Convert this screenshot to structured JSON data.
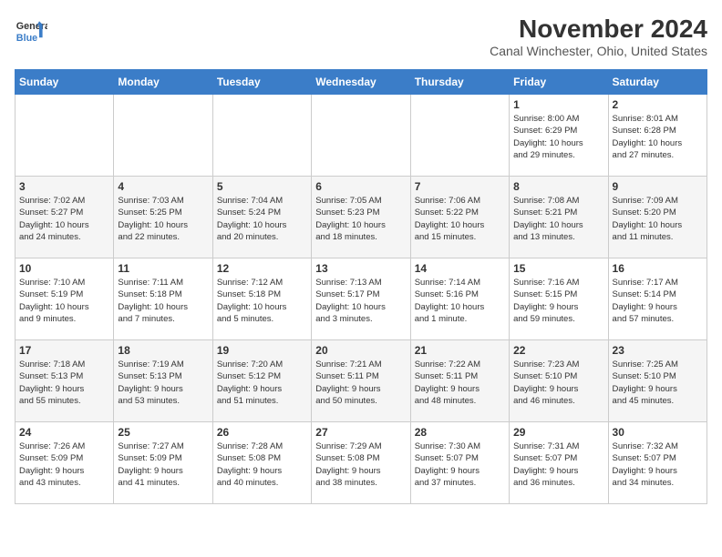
{
  "logo": {
    "line1": "General",
    "line2": "Blue"
  },
  "title": "November 2024",
  "location": "Canal Winchester, Ohio, United States",
  "weekdays": [
    "Sunday",
    "Monday",
    "Tuesday",
    "Wednesday",
    "Thursday",
    "Friday",
    "Saturday"
  ],
  "weeks": [
    [
      {
        "day": "",
        "info": ""
      },
      {
        "day": "",
        "info": ""
      },
      {
        "day": "",
        "info": ""
      },
      {
        "day": "",
        "info": ""
      },
      {
        "day": "",
        "info": ""
      },
      {
        "day": "1",
        "info": "Sunrise: 8:00 AM\nSunset: 6:29 PM\nDaylight: 10 hours\nand 29 minutes."
      },
      {
        "day": "2",
        "info": "Sunrise: 8:01 AM\nSunset: 6:28 PM\nDaylight: 10 hours\nand 27 minutes."
      }
    ],
    [
      {
        "day": "3",
        "info": "Sunrise: 7:02 AM\nSunset: 5:27 PM\nDaylight: 10 hours\nand 24 minutes."
      },
      {
        "day": "4",
        "info": "Sunrise: 7:03 AM\nSunset: 5:25 PM\nDaylight: 10 hours\nand 22 minutes."
      },
      {
        "day": "5",
        "info": "Sunrise: 7:04 AM\nSunset: 5:24 PM\nDaylight: 10 hours\nand 20 minutes."
      },
      {
        "day": "6",
        "info": "Sunrise: 7:05 AM\nSunset: 5:23 PM\nDaylight: 10 hours\nand 18 minutes."
      },
      {
        "day": "7",
        "info": "Sunrise: 7:06 AM\nSunset: 5:22 PM\nDaylight: 10 hours\nand 15 minutes."
      },
      {
        "day": "8",
        "info": "Sunrise: 7:08 AM\nSunset: 5:21 PM\nDaylight: 10 hours\nand 13 minutes."
      },
      {
        "day": "9",
        "info": "Sunrise: 7:09 AM\nSunset: 5:20 PM\nDaylight: 10 hours\nand 11 minutes."
      }
    ],
    [
      {
        "day": "10",
        "info": "Sunrise: 7:10 AM\nSunset: 5:19 PM\nDaylight: 10 hours\nand 9 minutes."
      },
      {
        "day": "11",
        "info": "Sunrise: 7:11 AM\nSunset: 5:18 PM\nDaylight: 10 hours\nand 7 minutes."
      },
      {
        "day": "12",
        "info": "Sunrise: 7:12 AM\nSunset: 5:18 PM\nDaylight: 10 hours\nand 5 minutes."
      },
      {
        "day": "13",
        "info": "Sunrise: 7:13 AM\nSunset: 5:17 PM\nDaylight: 10 hours\nand 3 minutes."
      },
      {
        "day": "14",
        "info": "Sunrise: 7:14 AM\nSunset: 5:16 PM\nDaylight: 10 hours\nand 1 minute."
      },
      {
        "day": "15",
        "info": "Sunrise: 7:16 AM\nSunset: 5:15 PM\nDaylight: 9 hours\nand 59 minutes."
      },
      {
        "day": "16",
        "info": "Sunrise: 7:17 AM\nSunset: 5:14 PM\nDaylight: 9 hours\nand 57 minutes."
      }
    ],
    [
      {
        "day": "17",
        "info": "Sunrise: 7:18 AM\nSunset: 5:13 PM\nDaylight: 9 hours\nand 55 minutes."
      },
      {
        "day": "18",
        "info": "Sunrise: 7:19 AM\nSunset: 5:13 PM\nDaylight: 9 hours\nand 53 minutes."
      },
      {
        "day": "19",
        "info": "Sunrise: 7:20 AM\nSunset: 5:12 PM\nDaylight: 9 hours\nand 51 minutes."
      },
      {
        "day": "20",
        "info": "Sunrise: 7:21 AM\nSunset: 5:11 PM\nDaylight: 9 hours\nand 50 minutes."
      },
      {
        "day": "21",
        "info": "Sunrise: 7:22 AM\nSunset: 5:11 PM\nDaylight: 9 hours\nand 48 minutes."
      },
      {
        "day": "22",
        "info": "Sunrise: 7:23 AM\nSunset: 5:10 PM\nDaylight: 9 hours\nand 46 minutes."
      },
      {
        "day": "23",
        "info": "Sunrise: 7:25 AM\nSunset: 5:10 PM\nDaylight: 9 hours\nand 45 minutes."
      }
    ],
    [
      {
        "day": "24",
        "info": "Sunrise: 7:26 AM\nSunset: 5:09 PM\nDaylight: 9 hours\nand 43 minutes."
      },
      {
        "day": "25",
        "info": "Sunrise: 7:27 AM\nSunset: 5:09 PM\nDaylight: 9 hours\nand 41 minutes."
      },
      {
        "day": "26",
        "info": "Sunrise: 7:28 AM\nSunset: 5:08 PM\nDaylight: 9 hours\nand 40 minutes."
      },
      {
        "day": "27",
        "info": "Sunrise: 7:29 AM\nSunset: 5:08 PM\nDaylight: 9 hours\nand 38 minutes."
      },
      {
        "day": "28",
        "info": "Sunrise: 7:30 AM\nSunset: 5:07 PM\nDaylight: 9 hours\nand 37 minutes."
      },
      {
        "day": "29",
        "info": "Sunrise: 7:31 AM\nSunset: 5:07 PM\nDaylight: 9 hours\nand 36 minutes."
      },
      {
        "day": "30",
        "info": "Sunrise: 7:32 AM\nSunset: 5:07 PM\nDaylight: 9 hours\nand 34 minutes."
      }
    ]
  ]
}
